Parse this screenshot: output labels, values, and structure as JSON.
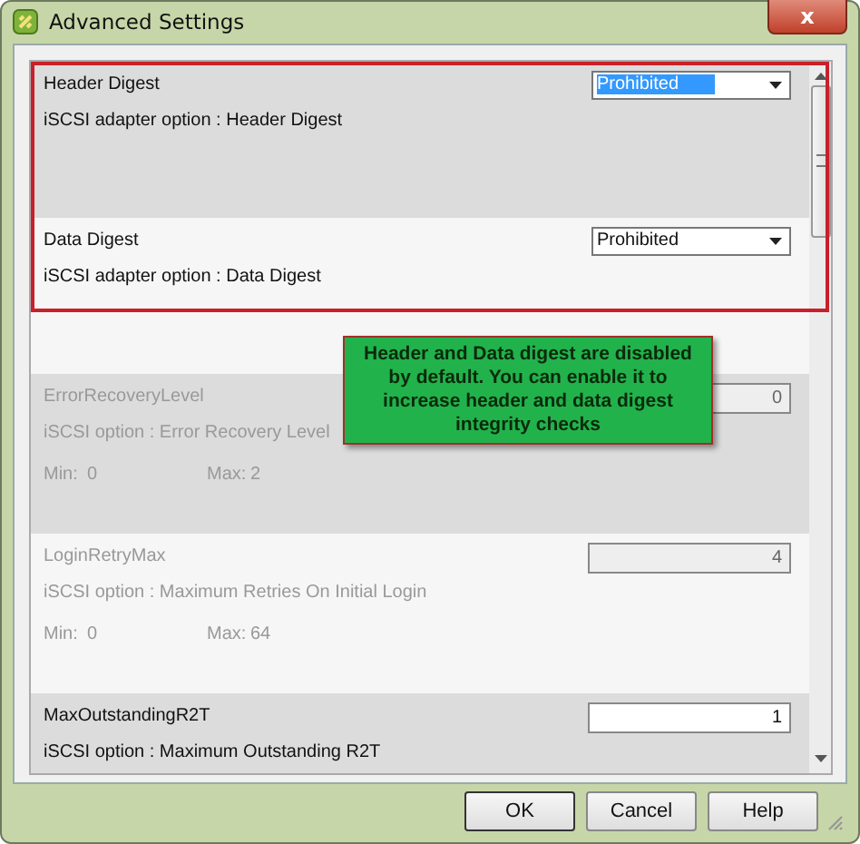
{
  "window": {
    "title": "Advanced Settings",
    "close": "x"
  },
  "settings": [
    {
      "kind": "select",
      "name": "Header Digest",
      "description": "iSCSI adapter option : Header Digest",
      "value": "Prohibited",
      "focused": true,
      "disabled": false
    },
    {
      "kind": "select",
      "name": "Data Digest",
      "description": "iSCSI adapter option : Data Digest",
      "value": "Prohibited",
      "focused": false,
      "disabled": false
    },
    {
      "kind": "number",
      "name": "ErrorRecoveryLevel",
      "description": "iSCSI option : Error Recovery Level",
      "value": "0",
      "min_label": "Min:",
      "min": "0",
      "max_label": "Max:",
      "max": "2",
      "disabled": true
    },
    {
      "kind": "number",
      "name": "LoginRetryMax",
      "description": "iSCSI option : Maximum Retries On Initial Login",
      "value": "4",
      "min_label": "Min:",
      "min": "0",
      "max_label": "Max:",
      "max": "64",
      "disabled": true
    },
    {
      "kind": "number",
      "name": "MaxOutstandingR2T",
      "description": "iSCSI option : Maximum Outstanding R2T",
      "value": "1",
      "disabled": false
    }
  ],
  "callout": "Header and Data digest are disabled by default. You can enable it to increase header and data digest integrity checks",
  "buttons": [
    "OK",
    "Cancel",
    "Help"
  ]
}
